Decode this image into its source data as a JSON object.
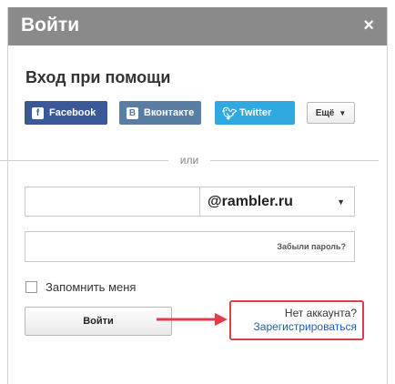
{
  "window": {
    "title": "Войти",
    "close_glyph": "×"
  },
  "heading": "Вход при помощи",
  "social": {
    "facebook": "Facebook",
    "vkontakte": "Вконтакте",
    "twitter": "Twitter",
    "more": "Ещё",
    "colors": {
      "facebook": "#3b5998",
      "vkontakte": "#597da3",
      "twitter": "#2fa9e0"
    }
  },
  "divider_text": "или",
  "login": {
    "value": "",
    "domain": "@rambler.ru"
  },
  "password": {
    "value": "",
    "forgot_label": "Забыли пароль?"
  },
  "remember_label": "Запомнить меня",
  "submit_label": "Войти",
  "register": {
    "question": "Нет аккаунта?",
    "link": "Зарегистрироваться",
    "highlight_color": "#e03c4c"
  }
}
